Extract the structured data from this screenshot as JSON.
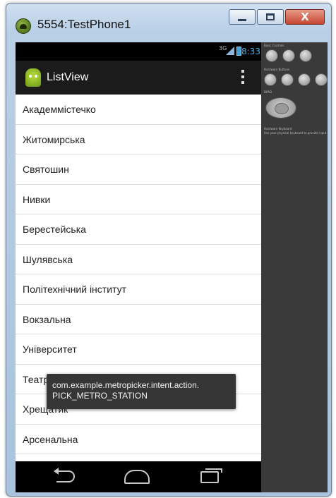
{
  "window": {
    "title": "5554:TestPhone1",
    "close_label": "X"
  },
  "statusbar": {
    "network": "3G",
    "time": "8:33"
  },
  "actionbar": {
    "title": "ListView"
  },
  "list": {
    "items": [
      "Академмістечко",
      "Житомирська",
      "Святошин",
      "Нивки",
      "Берестейська",
      "Шулявська",
      "Політехнічний інститут",
      "Вокзальна",
      "Університет",
      "Театральна",
      "Хрещатик",
      "Арсенальна"
    ]
  },
  "toast": {
    "line1": "com.example.metropicker.intent.action.",
    "line2": "PICK_METRO_STATION"
  },
  "controls": {
    "basic_label": "Basic Controls",
    "hardware_label": "Hardware Buttons",
    "dpad_label": "DPAD",
    "keyboard_label": "Hardware Keyboard",
    "keyboard_hint": "Use your physical keyboard to provide input"
  }
}
